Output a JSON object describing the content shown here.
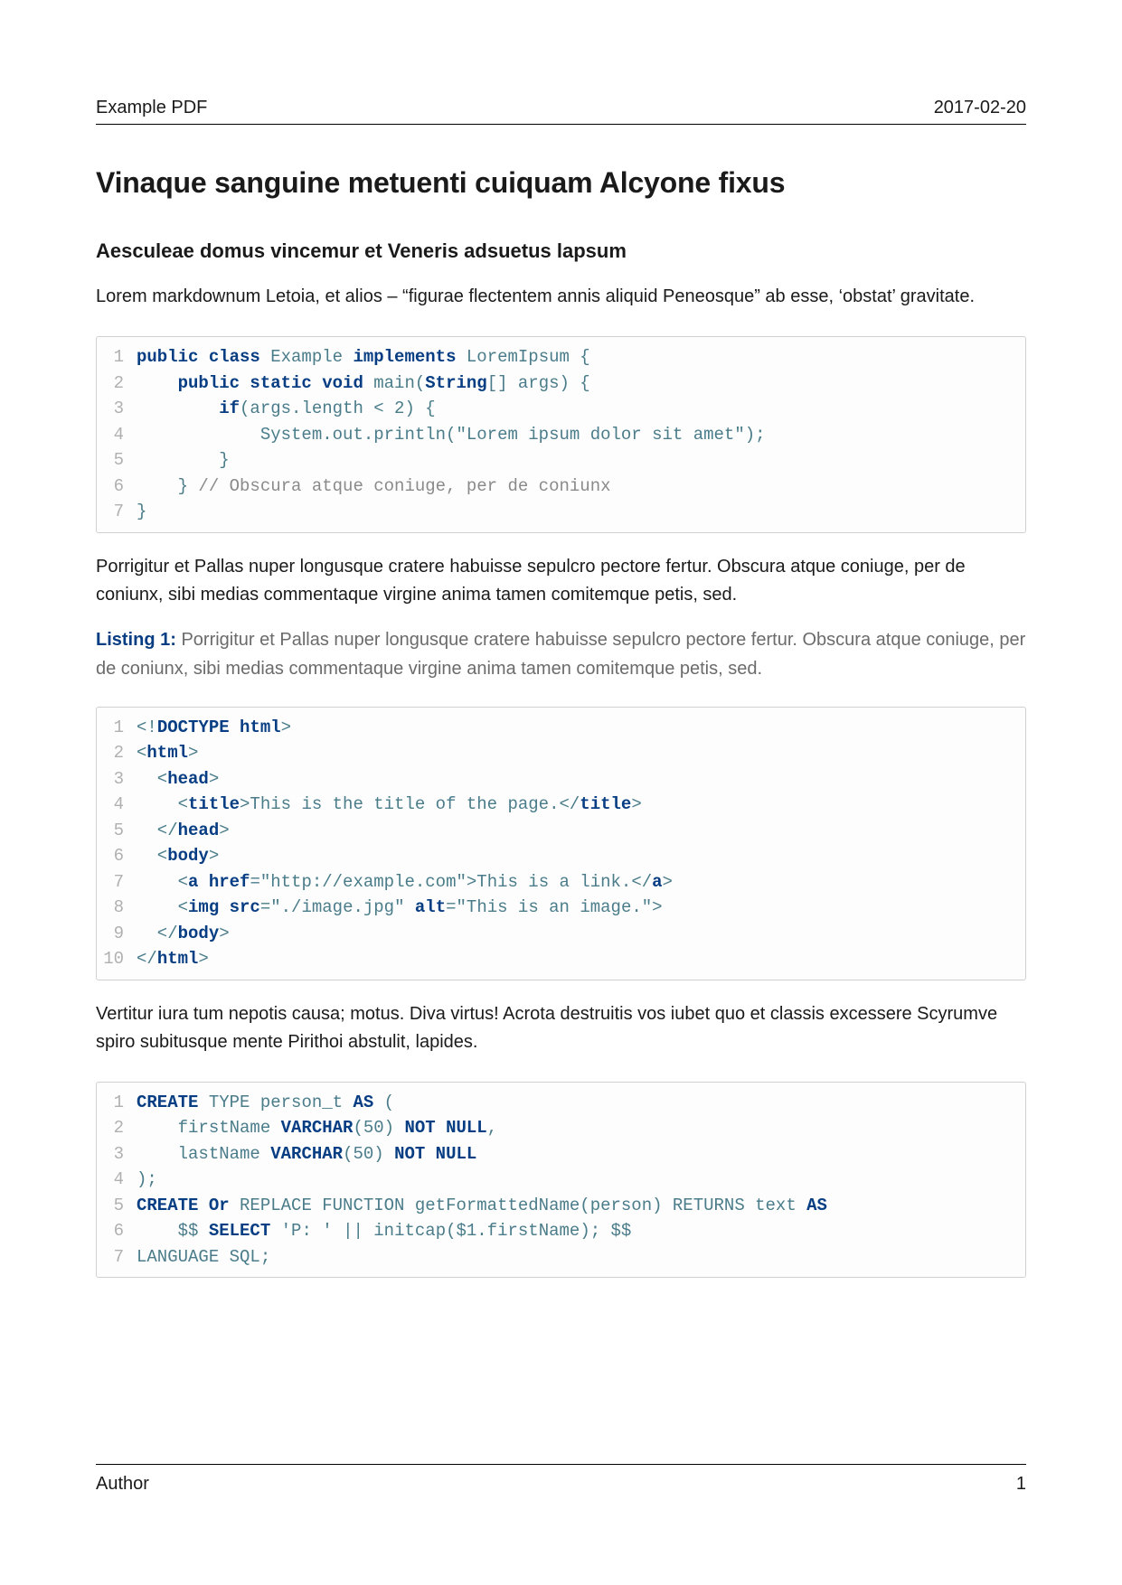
{
  "header": {
    "left": "Example PDF",
    "right": "2017-02-20"
  },
  "h1": "Vinaque sanguine metuenti cuiquam Alcyone fixus",
  "h2": "Aesculeae domus vincemur et Veneris adsuetus lapsum",
  "p1": "Lorem markdownum Letoia, et alios – “figurae flectentem annis aliquid Peneosque” ab esse, ‘obstat’ gravitate.",
  "code1": {
    "language": "java",
    "lines": [
      [
        [
          "kw",
          "public class"
        ],
        [
          "plain",
          " Example "
        ],
        [
          "kw",
          "implements"
        ],
        [
          "plain",
          " LoremIpsum {"
        ]
      ],
      [
        [
          "plain",
          "    "
        ],
        [
          "kw",
          "public static void"
        ],
        [
          "plain",
          " main("
        ],
        [
          "type",
          "String"
        ],
        [
          "plain",
          "[] args) {"
        ]
      ],
      [
        [
          "plain",
          "        "
        ],
        [
          "kw",
          "if"
        ],
        [
          "plain",
          "(args.length < 2) {"
        ]
      ],
      [
        [
          "plain",
          "            System.out.println("
        ],
        [
          "str",
          "\"Lorem ipsum dolor sit amet\""
        ],
        [
          "plain",
          ");"
        ]
      ],
      [
        [
          "plain",
          "        }"
        ]
      ],
      [
        [
          "plain",
          "    } "
        ],
        [
          "com",
          "// Obscura atque coniuge, per de coniunx"
        ]
      ],
      [
        [
          "plain",
          "}"
        ]
      ]
    ]
  },
  "p2": "Porrigitur et Pallas nuper longusque cratere habuisse sepulcro pectore fertur. Obscura atque coniuge, per de coniunx, sibi medias commentaque virgine anima tamen comitemque petis, sed.",
  "listing": {
    "label": "Listing 1:",
    "caption": " Porrigitur et Pallas nuper longusque cratere habuisse sepulcro pectore fertur. Obscura atque coniuge, per de coniunx, sibi medias commentaque virgine anima tamen comitemque petis, sed."
  },
  "code2": {
    "language": "html",
    "lines": [
      [
        [
          "plain",
          "<!"
        ],
        [
          "kw",
          "DOCTYPE html"
        ],
        [
          "plain",
          ">"
        ]
      ],
      [
        [
          "plain",
          "<"
        ],
        [
          "kw",
          "html"
        ],
        [
          "plain",
          ">"
        ]
      ],
      [
        [
          "plain",
          "  <"
        ],
        [
          "kw",
          "head"
        ],
        [
          "plain",
          ">"
        ]
      ],
      [
        [
          "plain",
          "    <"
        ],
        [
          "kw",
          "title"
        ],
        [
          "plain",
          ">This is the title of the page.</"
        ],
        [
          "kw",
          "title"
        ],
        [
          "plain",
          ">"
        ]
      ],
      [
        [
          "plain",
          "  </"
        ],
        [
          "kw",
          "head"
        ],
        [
          "plain",
          ">"
        ]
      ],
      [
        [
          "plain",
          "  <"
        ],
        [
          "kw",
          "body"
        ],
        [
          "plain",
          ">"
        ]
      ],
      [
        [
          "plain",
          "    <"
        ],
        [
          "kw",
          "a href"
        ],
        [
          "plain",
          "="
        ],
        [
          "str",
          "\"http://example.com\""
        ],
        [
          "plain",
          ">This is a link.</"
        ],
        [
          "kw",
          "a"
        ],
        [
          "plain",
          ">"
        ]
      ],
      [
        [
          "plain",
          "    <"
        ],
        [
          "kw",
          "img src"
        ],
        [
          "plain",
          "="
        ],
        [
          "str",
          "\"./image.jpg\""
        ],
        [
          "plain",
          " "
        ],
        [
          "kw",
          "alt"
        ],
        [
          "plain",
          "="
        ],
        [
          "str",
          "\"This is an image.\""
        ],
        [
          "plain",
          ">"
        ]
      ],
      [
        [
          "plain",
          "  </"
        ],
        [
          "kw",
          "body"
        ],
        [
          "plain",
          ">"
        ]
      ],
      [
        [
          "plain",
          "</"
        ],
        [
          "kw",
          "html"
        ],
        [
          "plain",
          ">"
        ]
      ]
    ]
  },
  "p3": "Vertitur iura tum nepotis causa; motus. Diva virtus! Acrota destruitis vos iubet quo et classis excessere Scyrumve spiro subitusque mente Pirithoi abstulit, lapides.",
  "code3": {
    "language": "sql",
    "lines": [
      [
        [
          "kw",
          "CREATE"
        ],
        [
          "plain",
          " TYPE person_t "
        ],
        [
          "kw",
          "AS"
        ],
        [
          "plain",
          " ("
        ]
      ],
      [
        [
          "plain",
          "    firstName "
        ],
        [
          "kw",
          "VARCHAR"
        ],
        [
          "plain",
          "(50) "
        ],
        [
          "kw",
          "NOT NULL"
        ],
        [
          "plain",
          ","
        ]
      ],
      [
        [
          "plain",
          "    lastName "
        ],
        [
          "kw",
          "VARCHAR"
        ],
        [
          "plain",
          "(50) "
        ],
        [
          "kw",
          "NOT NULL"
        ]
      ],
      [
        [
          "plain",
          ");"
        ]
      ],
      [
        [
          "kw",
          "CREATE Or"
        ],
        [
          "plain",
          " REPLACE FUNCTION getFormattedName(person) RETURNS text "
        ],
        [
          "kw",
          "AS"
        ]
      ],
      [
        [
          "plain",
          "    $$ "
        ],
        [
          "kw",
          "SELECT"
        ],
        [
          "plain",
          " "
        ],
        [
          "str",
          "'P: '"
        ],
        [
          "plain",
          " || initcap($1.firstName); $$"
        ]
      ],
      [
        [
          "plain",
          "LANGUAGE SQL;"
        ]
      ]
    ]
  },
  "footer": {
    "left": "Author",
    "right": "1"
  }
}
